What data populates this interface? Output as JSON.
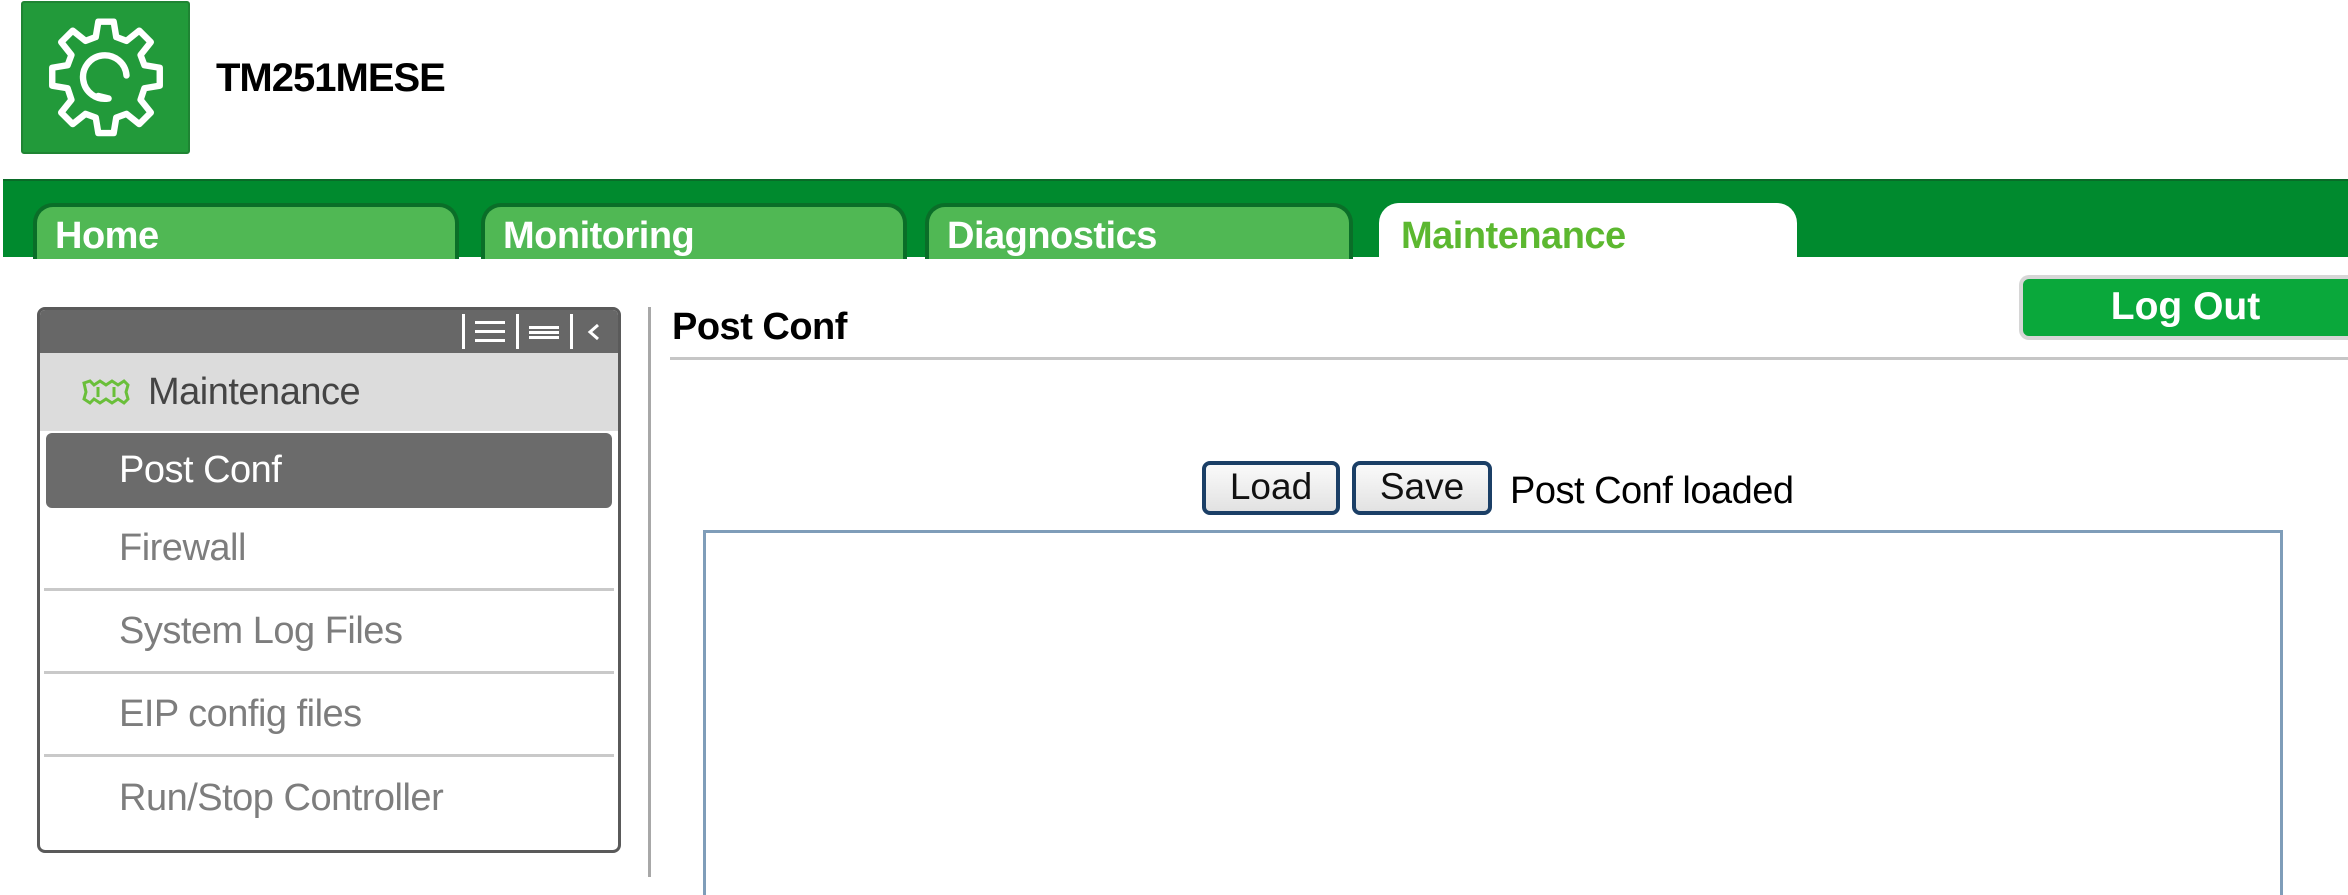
{
  "header": {
    "logo_icon": "gear-icon",
    "device_name": "TM251MESE"
  },
  "nav": {
    "tabs": [
      {
        "label": "Home",
        "active": false
      },
      {
        "label": "Monitoring",
        "active": false
      },
      {
        "label": "Diagnostics",
        "active": false
      },
      {
        "label": "Maintenance",
        "active": true
      }
    ]
  },
  "logout_label": "Log Out",
  "sidebar": {
    "tools": [
      "expand-all-icon",
      "collapse-all-icon",
      "chevron-left-icon"
    ],
    "section_label": "Maintenance",
    "section_icon": "maintenance-icon",
    "items": [
      {
        "label": "Post Conf",
        "active": true
      },
      {
        "label": "Firewall",
        "active": false
      },
      {
        "label": "System Log Files",
        "active": false
      },
      {
        "label": "EIP config files",
        "active": false
      },
      {
        "label": "Run/Stop Controller",
        "active": false
      }
    ]
  },
  "main": {
    "title": "Post Conf",
    "load_label": "Load",
    "save_label": "Save",
    "status": "Post Conf loaded",
    "editor_content": ""
  },
  "colors": {
    "brand_green": "#008a2e",
    "tab_green": "#50b854",
    "active_tab_text": "#5cb830",
    "logout_green": "#0aa83b",
    "sidebar_active": "#6b6b6b",
    "editor_border": "#7f9db9"
  }
}
